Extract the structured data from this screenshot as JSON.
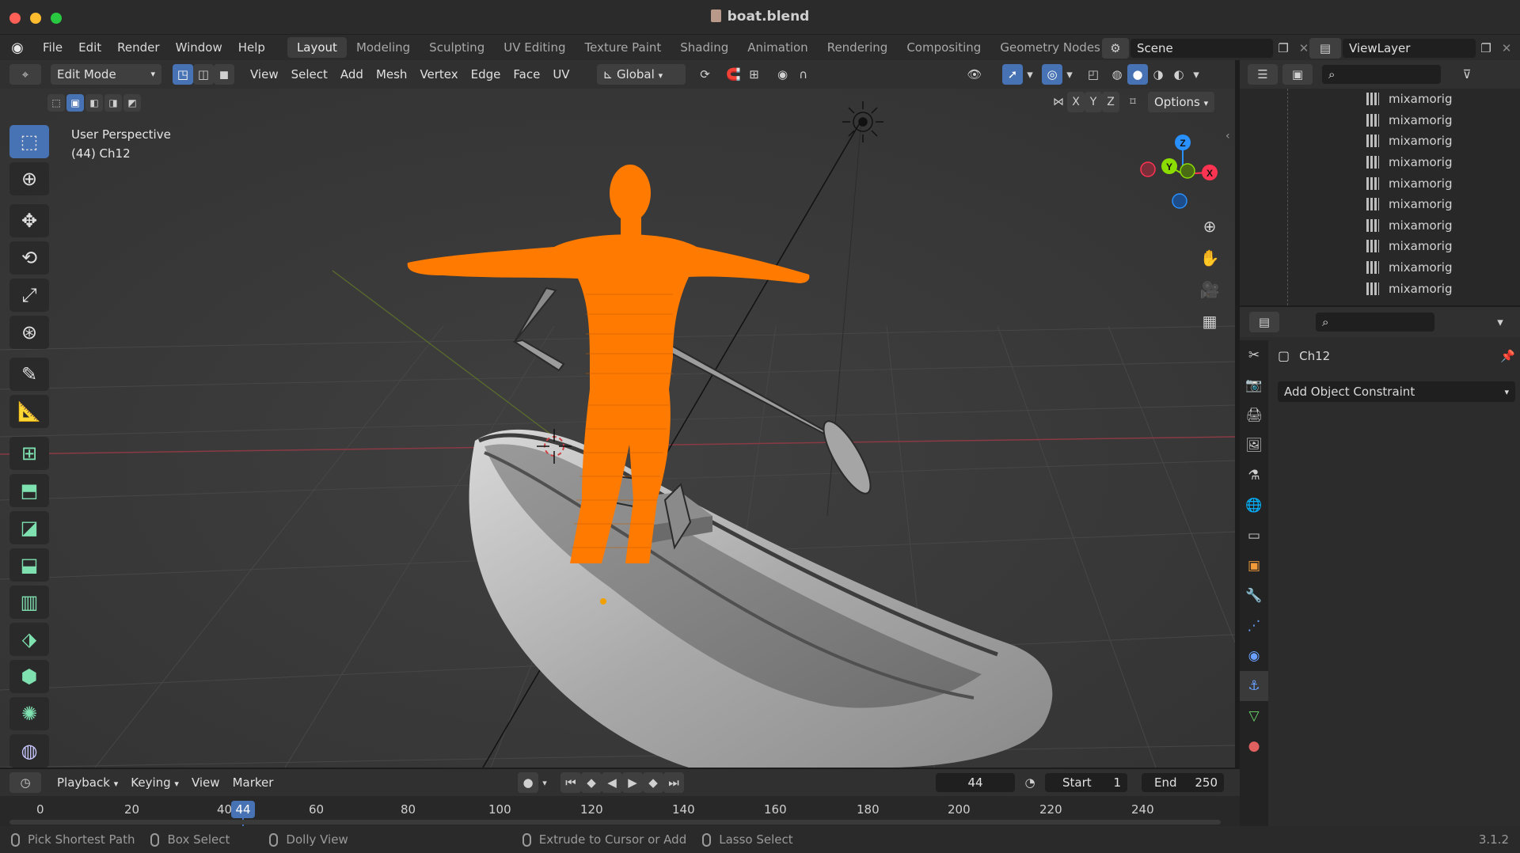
{
  "window": {
    "title": "boat.blend"
  },
  "menu": {
    "items": [
      "File",
      "Edit",
      "Render",
      "Window",
      "Help"
    ],
    "workspaces": [
      "Layout",
      "Modeling",
      "Sculpting",
      "UV Editing",
      "Texture Paint",
      "Shading",
      "Animation",
      "Rendering",
      "Compositing",
      "Geometry Nodes"
    ],
    "active_workspace": "Layout",
    "scene": "Scene",
    "view_layer": "ViewLayer"
  },
  "viewport_header": {
    "mode": "Edit Mode",
    "menus": [
      "View",
      "Select",
      "Add",
      "Mesh",
      "Vertex",
      "Edge",
      "Face",
      "UV"
    ],
    "orientation": "Global",
    "options": "Options",
    "axes": [
      "X",
      "Y",
      "Z"
    ]
  },
  "viewport": {
    "perspective": "User Perspective",
    "object": "(44) Ch12",
    "gizmo_axes": [
      "Z",
      "Y",
      "X"
    ]
  },
  "outliner": {
    "items": [
      "mixamorig",
      "mixamorig",
      "mixamorig",
      "mixamorig",
      "mixamorig",
      "mixamorig",
      "mixamorig",
      "mixamorig",
      "mixamorig",
      "mixamorig"
    ]
  },
  "properties": {
    "object_name": "Ch12",
    "add_constraint": "Add Object Constraint"
  },
  "timeline": {
    "menus": [
      "Playback",
      "Keying",
      "View",
      "Marker"
    ],
    "current_frame": "44",
    "start_label": "Start",
    "start_value": "1",
    "end_label": "End",
    "end_value": "250",
    "ticks": [
      "0",
      "20",
      "40",
      "60",
      "80",
      "100",
      "120",
      "140",
      "160",
      "180",
      "200",
      "220",
      "240"
    ],
    "playhead": "44"
  },
  "status": {
    "items": [
      "Pick Shortest Path",
      "Box Select",
      "Dolly View",
      "Extrude to Cursor or Add",
      "Lasso Select"
    ],
    "version": "3.1.2"
  },
  "colors": {
    "accent": "#4772b3",
    "selection_orange": "#ff7a00",
    "axis_x": "#ff3352",
    "axis_y": "#8bdc00",
    "axis_z": "#2890ff"
  }
}
